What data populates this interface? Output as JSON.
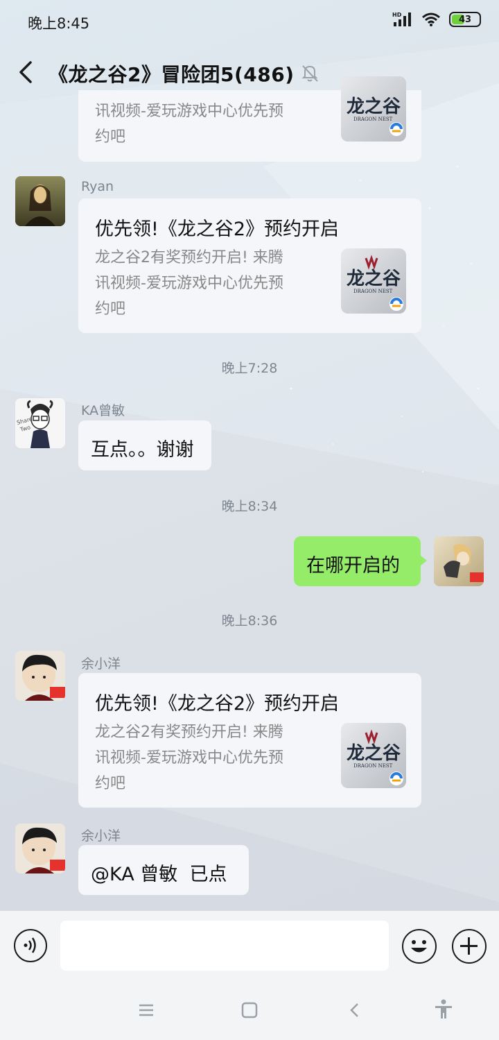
{
  "status_bar": {
    "time": "晚上8:45",
    "battery": "43",
    "network": "HD"
  },
  "header": {
    "title": "《龙之谷2》冒险团5(486)"
  },
  "messages": [
    {
      "type": "card",
      "sender": "",
      "desc_tail": "讯视频-爱玩游戏中心优先预约吧"
    },
    {
      "type": "card",
      "sender": "Ryan",
      "title": "优先领!《龙之谷2》预约开启",
      "desc": "龙之谷2有奖预约开启! 来腾讯视频-爱玩游戏中心优先预约吧"
    },
    {
      "type": "time",
      "text": "晚上7:28"
    },
    {
      "type": "text",
      "sender": "KA曾敏",
      "text": "互点。。谢谢"
    },
    {
      "type": "time",
      "text": "晚上8:34"
    },
    {
      "type": "self",
      "text": "在哪开启的"
    },
    {
      "type": "time",
      "text": "晚上8:36"
    },
    {
      "type": "card",
      "sender": "余小洋",
      "title": "优先领!《龙之谷2》预约开启",
      "desc": "龙之谷2有奖预约开启! 来腾讯视频-爱玩游戏中心优先预约吧"
    },
    {
      "type": "text",
      "sender": "余小洋",
      "text": "@KA 曾敏  已点"
    }
  ],
  "card_desc_lines": {
    "line1": "龙之谷2有奖预约开启! 来腾",
    "line2": "讯视频-爱玩游戏中心优先预",
    "line3": "约吧"
  },
  "thumb": {
    "main": "龙之谷",
    "sub": "DRAGON NEST"
  },
  "avatar_ka": {
    "line1": "Share",
    "line2": "Two"
  },
  "colors": {
    "self_bubble": "#95ec69",
    "bubble": "#f4f6f9",
    "flag": "#e5322d"
  }
}
